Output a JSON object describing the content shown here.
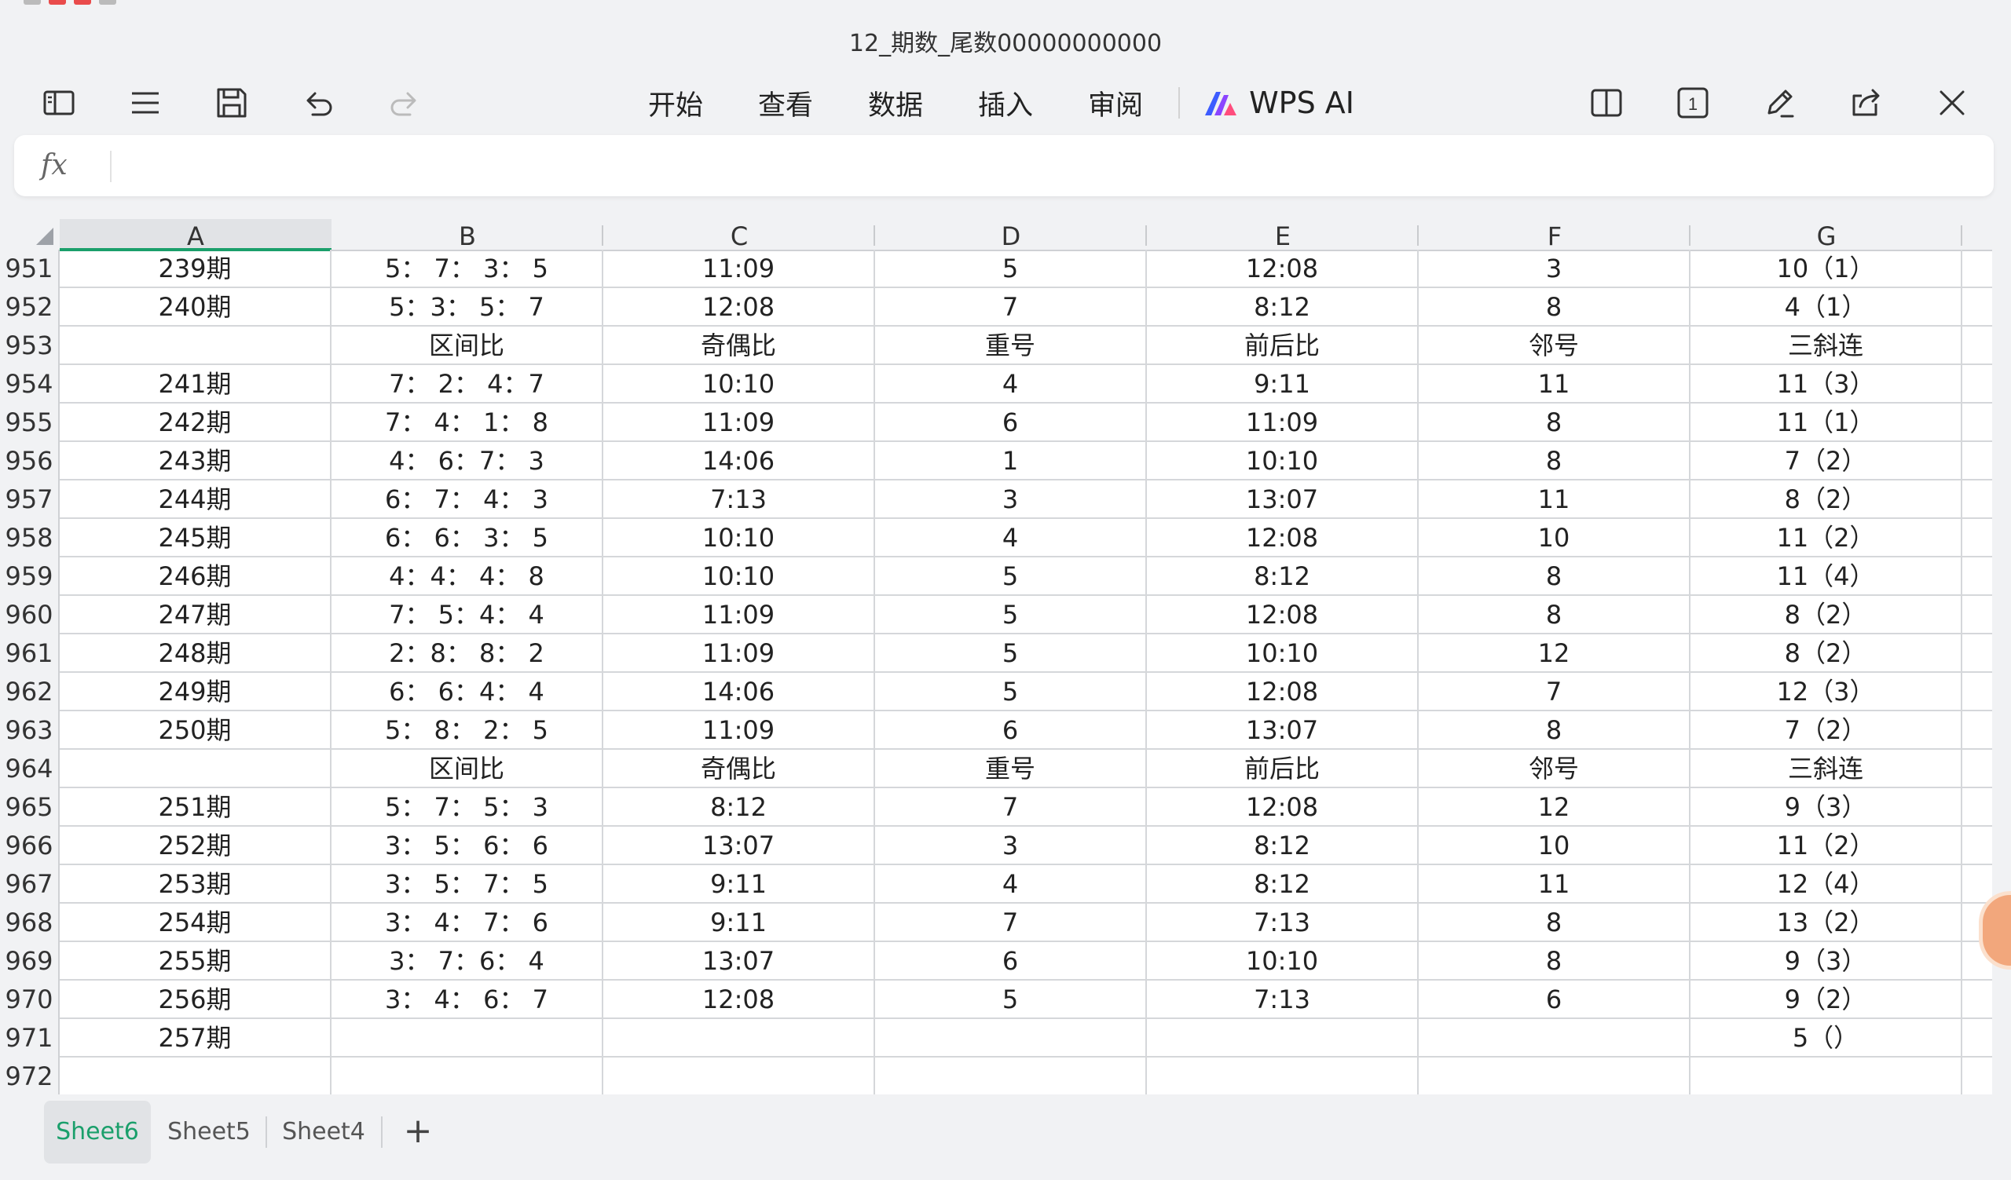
{
  "window": {
    "title": "12_期数_尾数00000000000"
  },
  "toolbar": {
    "menu": [
      "开始",
      "查看",
      "数据",
      "插入",
      "审阅"
    ],
    "ai_label": "WPS AI",
    "page_count_label": "1"
  },
  "formula_bar": {
    "fx_label": "fx",
    "value": ""
  },
  "grid": {
    "selected_column": "A",
    "columns": [
      "A",
      "B",
      "C",
      "D",
      "E",
      "F",
      "G"
    ],
    "rows": [
      {
        "num": "951",
        "cells": [
          "239期",
          "5： 7： 3： 5",
          "11:09",
          "5",
          "12:08",
          "3",
          "10（1）"
        ]
      },
      {
        "num": "952",
        "cells": [
          "240期",
          "5：3： 5： 7",
          "12:08",
          "7",
          "8:12",
          "8",
          "4（1）"
        ]
      },
      {
        "num": "953",
        "cells": [
          "",
          "区间比",
          "奇偶比",
          "重号",
          "前后比",
          "邻号",
          "三斜连"
        ]
      },
      {
        "num": "954",
        "cells": [
          "241期",
          "7： 2： 4：7",
          "10:10",
          "4",
          "9:11",
          "11",
          "11（3）"
        ]
      },
      {
        "num": "955",
        "cells": [
          "242期",
          "7： 4： 1： 8",
          "11:09",
          "6",
          "11:09",
          "8",
          "11（1）"
        ]
      },
      {
        "num": "956",
        "cells": [
          "243期",
          "4： 6：7： 3",
          "14:06",
          "1",
          "10:10",
          "8",
          "7（2）"
        ]
      },
      {
        "num": "957",
        "cells": [
          "244期",
          "6： 7： 4： 3",
          "7:13",
          "3",
          "13:07",
          "11",
          "8（2）"
        ]
      },
      {
        "num": "958",
        "cells": [
          "245期",
          "6： 6： 3： 5",
          "10:10",
          "4",
          "12:08",
          "10",
          "11（2）"
        ]
      },
      {
        "num": "959",
        "cells": [
          "246期",
          "4：4： 4： 8",
          "10:10",
          "5",
          "8:12",
          "8",
          "11（4）"
        ]
      },
      {
        "num": "960",
        "cells": [
          "247期",
          "7： 5：4： 4",
          "11:09",
          "5",
          "12:08",
          "8",
          "8（2）"
        ]
      },
      {
        "num": "961",
        "cells": [
          "248期",
          "2：8： 8： 2",
          "11:09",
          "5",
          "10:10",
          "12",
          "8（2）"
        ]
      },
      {
        "num": "962",
        "cells": [
          "249期",
          "6： 6：4： 4",
          "14:06",
          "5",
          "12:08",
          "7",
          "12（3）"
        ]
      },
      {
        "num": "963",
        "cells": [
          "250期",
          "5： 8： 2： 5",
          "11:09",
          "6",
          "13:07",
          "8",
          "7（2）"
        ]
      },
      {
        "num": "964",
        "cells": [
          "",
          "区间比",
          "奇偶比",
          "重号",
          "前后比",
          "邻号",
          "三斜连"
        ]
      },
      {
        "num": "965",
        "cells": [
          "251期",
          "5： 7： 5： 3",
          "8:12",
          "7",
          "12:08",
          "12",
          "9（3）"
        ]
      },
      {
        "num": "966",
        "cells": [
          "252期",
          "3： 5： 6： 6",
          "13:07",
          "3",
          "8:12",
          "10",
          "11（2）"
        ]
      },
      {
        "num": "967",
        "cells": [
          "253期",
          "3： 5： 7： 5",
          "9:11",
          "4",
          "8:12",
          "11",
          "12（4）"
        ]
      },
      {
        "num": "968",
        "cells": [
          "254期",
          "3： 4： 7： 6",
          "9:11",
          "7",
          "7:13",
          "8",
          "13（2）"
        ]
      },
      {
        "num": "969",
        "cells": [
          "255期",
          "3： 7：6： 4",
          "13:07",
          "6",
          "10:10",
          "8",
          "9（3）"
        ]
      },
      {
        "num": "970",
        "cells": [
          "256期",
          "3： 4： 6： 7",
          "12:08",
          "5",
          "7:13",
          "6",
          "9（2）"
        ]
      },
      {
        "num": "971",
        "cells": [
          "257期",
          "",
          "",
          "",
          "",
          "",
          "5（）"
        ]
      },
      {
        "num": "972",
        "cells": [
          "",
          "",
          "",
          "",
          "",
          "",
          ""
        ]
      }
    ]
  },
  "sheets": {
    "tabs": [
      "Sheet6",
      "Sheet5",
      "Sheet4"
    ],
    "active": "Sheet6",
    "add_label": "+"
  },
  "colors": {
    "accent": "#1a9f6b",
    "background": "#f1f2f4"
  }
}
